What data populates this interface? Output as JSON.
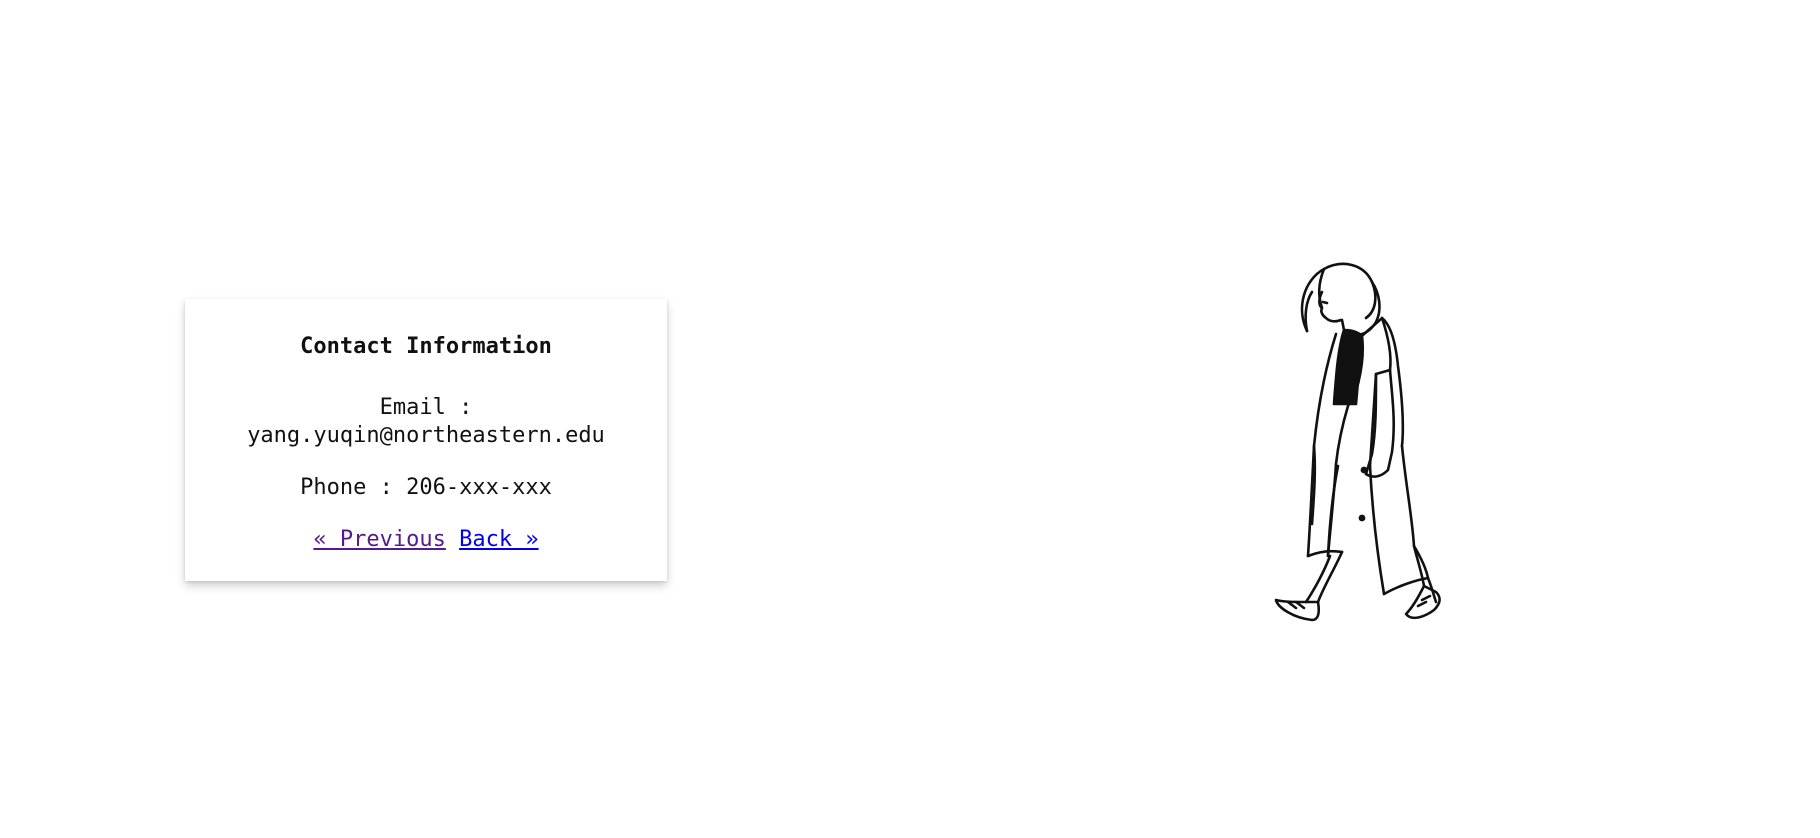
{
  "contact": {
    "title": "Contact Information",
    "email_label": "Email :",
    "email_value": "yang.yuqin@northeastern.edu",
    "phone_text": "Phone : 206-xxx-xxx",
    "previous_link": "« Previous",
    "back_link": "Back »"
  },
  "colors": {
    "visited_link": "#551a8b",
    "link": "#0000ee",
    "text": "#111111",
    "background": "#ffffff"
  },
  "illustration": {
    "icon": "walking-woman-illustration"
  }
}
